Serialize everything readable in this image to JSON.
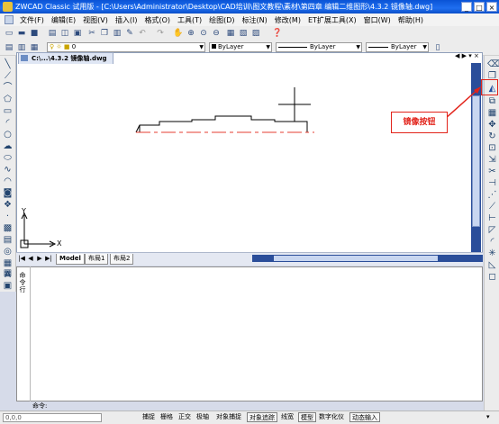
{
  "window": {
    "title": "ZWCAD Classic 试用版 - [C:\\Users\\Administrator\\Desktop\\CAD培训\\图文教程\\素材\\第四章 编辑二维图形\\4.3.2 镜像轴.dwg]",
    "controls": [
      "_",
      "□",
      "×"
    ]
  },
  "menubar": {
    "items": [
      "文件(F)",
      "编辑(E)",
      "视图(V)",
      "插入(I)",
      "格式(O)",
      "工具(T)",
      "绘图(D)",
      "标注(N)",
      "修改(M)",
      "ET扩展工具(X)",
      "窗口(W)",
      "帮助(H)"
    ]
  },
  "toolbar": {
    "layer_value": "0",
    "color_value": "ByLayer",
    "linetype_value": "ByLayer",
    "lineweight_value": "ByLayer"
  },
  "document": {
    "tab_title": "C:\\...\\4.3.2 镜像轴.dwg",
    "layout_tabs": [
      "Model",
      "布局1",
      "布局2"
    ],
    "axis_x": "X",
    "axis_y": "Y"
  },
  "command": {
    "label": "命令行",
    "prompt": "命令:"
  },
  "status": {
    "coords": "0,0,0",
    "buttons": [
      "捕捉",
      "栅格",
      "正交",
      "极轴",
      "对象捕捉",
      "对象追踪",
      "线宽",
      "模型",
      "数字化仪",
      "动态输入"
    ]
  },
  "annotation": {
    "callout_text": "镜像按钮"
  },
  "colors": {
    "accent": "#e2231a",
    "title": "#1f6ff0"
  }
}
